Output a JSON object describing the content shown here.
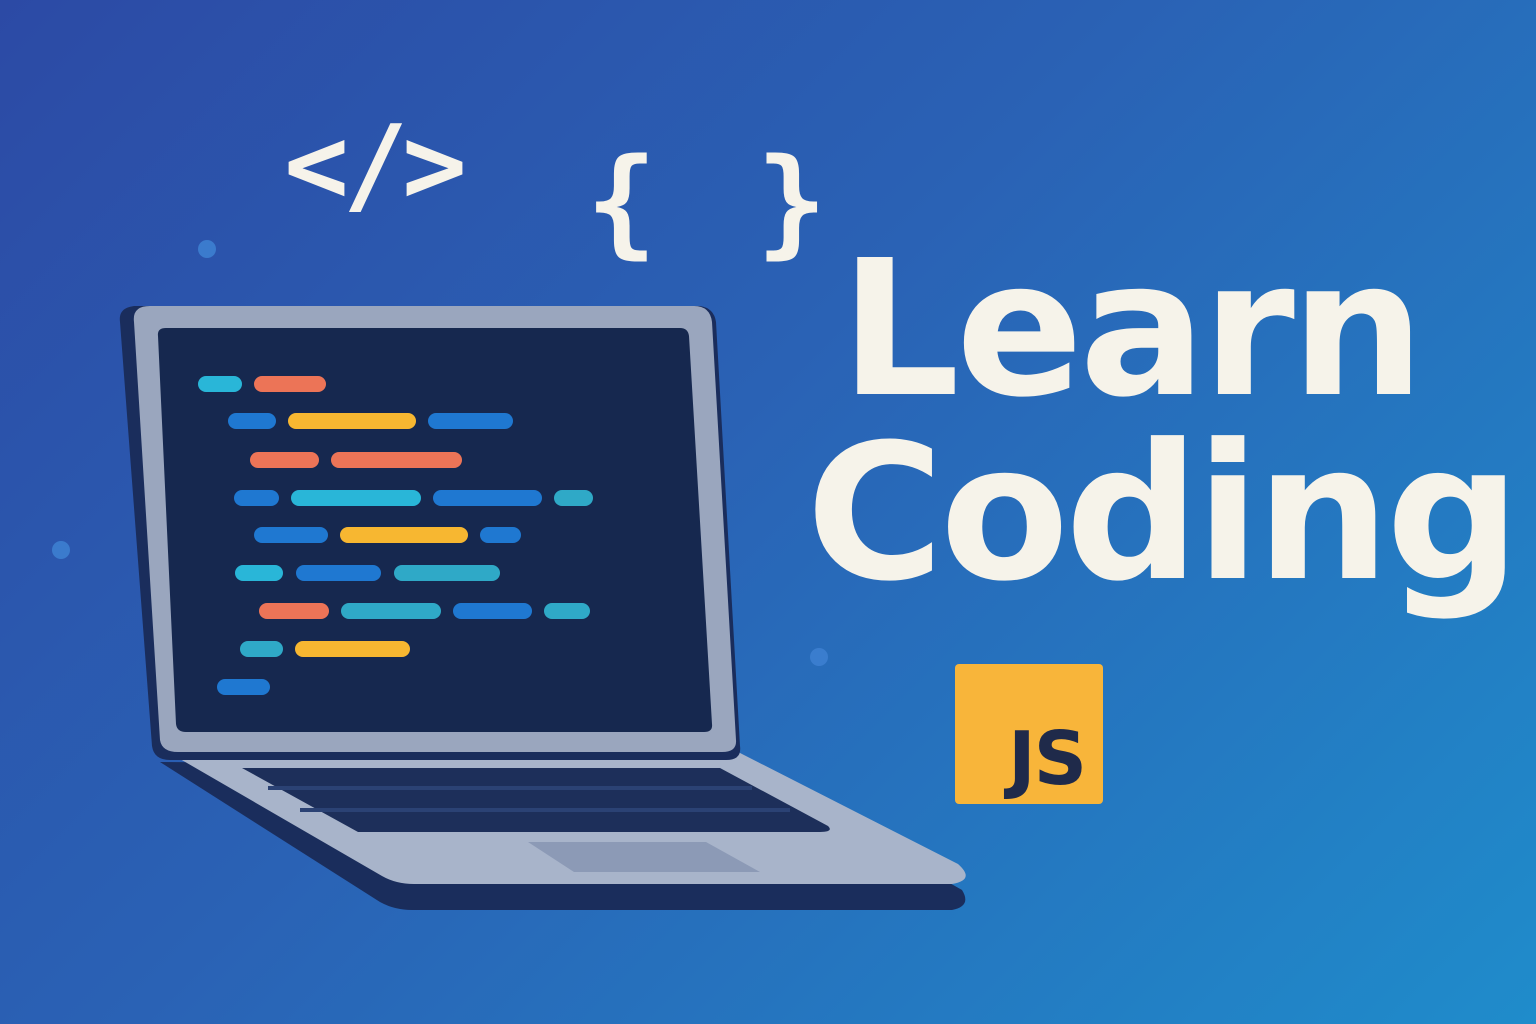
{
  "headline": {
    "line1": "Learn",
    "line2": "Coding"
  },
  "decorations": {
    "code_tag_glyph": "</>",
    "braces_glyph": "{ }"
  },
  "badge": {
    "label": "JS",
    "color": "#f8b53a",
    "text_color": "#1f2a4a"
  },
  "icons": [
    "laptop-icon",
    "code-tag-icon",
    "curly-braces-icon",
    "javascript-logo-icon"
  ],
  "colors": {
    "background_start": "#2c4aa5",
    "background_end": "#1f8ccb",
    "text": "#f6f3ea",
    "screen": "#16284f",
    "laptop_body": "#9aa6be",
    "code_cyan": "#29b6d8",
    "code_orange": "#ec7457",
    "code_blue": "#1f78d1",
    "code_yellow": "#f7b731",
    "code_teal": "#2fa9c7"
  }
}
